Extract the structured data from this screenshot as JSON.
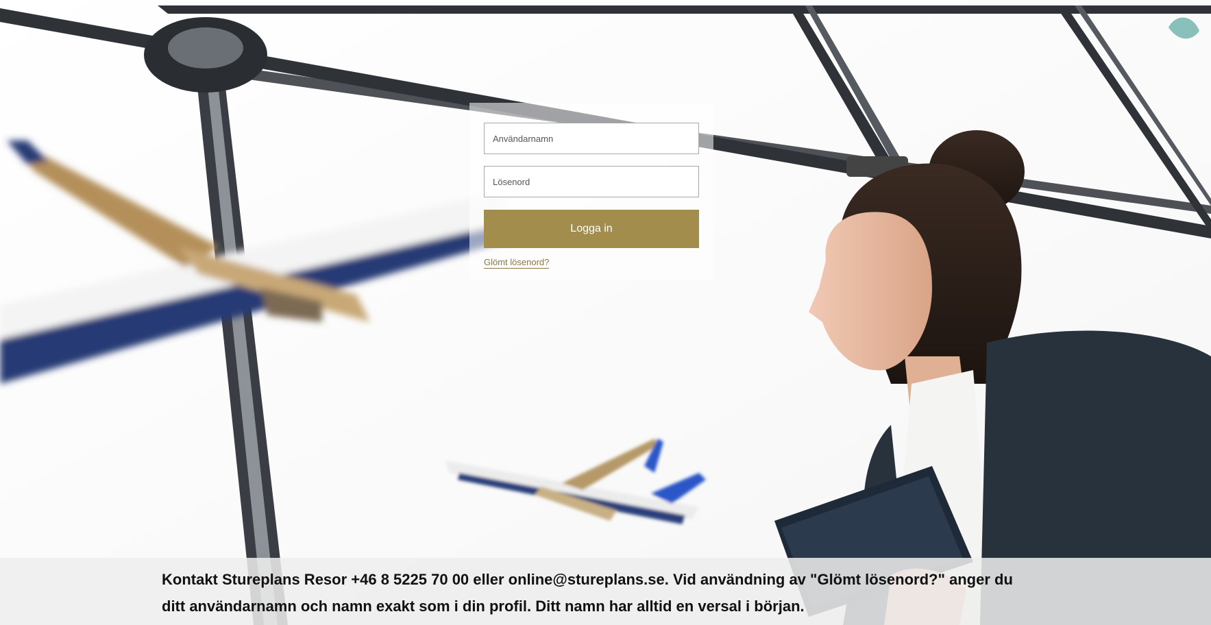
{
  "login": {
    "username_placeholder": "Användarnamn",
    "password_placeholder": "Lösenord",
    "submit_label": "Logga in",
    "forgot_link": "Glömt lösenord?"
  },
  "footer": {
    "info_text": "Kontakt Stureplans Resor +46 8 5225 70 00 eller online@stureplans.se. Vid användning av \"Glömt lösenord?\" anger du ditt användarnamn och namn exakt som i din profil. Ditt namn har alltid en versal i början."
  },
  "colors": {
    "accent": "#a38d4d",
    "link": "#8c7744",
    "footer_bg": "#eeeeee",
    "sky_blue": "#1f3d8a",
    "suit": "#27323d"
  },
  "background": {
    "icons": [
      "airplane-icon",
      "window-frame",
      "businesswoman-photo",
      "tablet-icon"
    ]
  }
}
